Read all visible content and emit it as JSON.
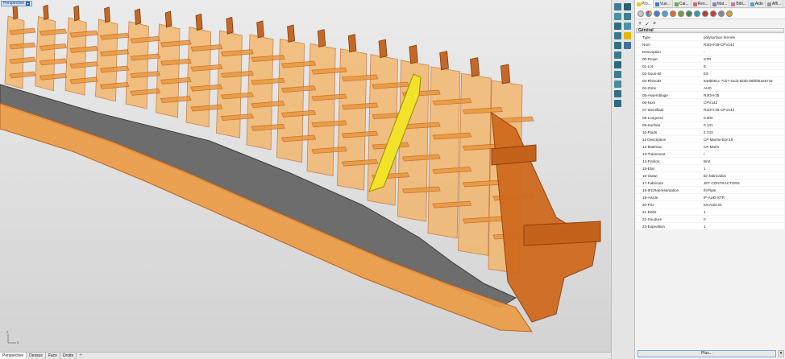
{
  "viewport": {
    "label": "Perspective",
    "axis_x": "x",
    "axis_z": "z",
    "tabs": [
      "Perspective",
      "Dessus",
      "Face",
      "Droite"
    ],
    "active_tab": "Perspective",
    "add_tab": "+"
  },
  "panel": {
    "tabs": [
      {
        "label": "Pro...",
        "color": "#f5c518"
      },
      {
        "label": "Vue...",
        "color": "#3a7bd5"
      },
      {
        "label": "Cal...",
        "color": "#6aa84f"
      },
      {
        "label": "Ren...",
        "color": "#e06666"
      },
      {
        "label": "Mat...",
        "color": "#8e7cc3"
      },
      {
        "label": "Bibl...",
        "color": "#c27ba0"
      },
      {
        "label": "Aide",
        "color": "#4ea1d3"
      },
      {
        "label": "Affi...",
        "color": "#999999"
      }
    ],
    "actions": [
      "+",
      "✓",
      "×"
    ],
    "section": "Général",
    "properties": [
      {
        "key": "Type",
        "value": "polysurface fermée"
      },
      {
        "key": "Nom",
        "value": "R3OH-35-CPV142"
      },
      {
        "key": "Description",
        "value": "-"
      },
      {
        "key": "00-Projet",
        "value": "STR"
      },
      {
        "key": "01-Lot",
        "value": "E"
      },
      {
        "key": "02-Sous-lot",
        "value": "E9"
      },
      {
        "key": "03-RhinoID",
        "value": "640bb61c-7cb7-41cb-923b-b8bf052a67c8"
      },
      {
        "key": "04-Zone",
        "value": "AUD"
      },
      {
        "key": "05-Assemblage",
        "value": "R3OH-35"
      },
      {
        "key": "06-Nom",
        "value": "CPV142"
      },
      {
        "key": "07-Identifiant",
        "value": "R3OH-35-CPV142"
      },
      {
        "key": "08-Longueur",
        "value": "0.000"
      },
      {
        "key": "09-Surface",
        "value": "0.141"
      },
      {
        "key": "10-Poids",
        "value": "2.743"
      },
      {
        "key": "11-Description",
        "value": "CP Marine Epr 18"
      },
      {
        "key": "12-Matériau",
        "value": "CP Marin"
      },
      {
        "key": "13-Traitement",
        "value": "/"
      },
      {
        "key": "14-Finition",
        "value": "Brut"
      },
      {
        "key": "15-Etat",
        "value": "1"
      },
      {
        "key": "16-Statut",
        "value": "En fabrication"
      },
      {
        "key": "17-Fabricant",
        "value": "JET CONTRACTORS"
      },
      {
        "key": "18-IFCRepresentation",
        "value": "IfcPlate"
      },
      {
        "key": "19-Article",
        "value": "IF-AUD-STR"
      },
      {
        "key": "20-Prix",
        "value": "E9.AUD.01"
      },
      {
        "key": "21-Debit",
        "value": "1"
      },
      {
        "key": "22-Soudure",
        "value": "0"
      },
      {
        "key": "23-Expedition",
        "value": "1"
      }
    ],
    "more_button": "Plus...",
    "more_caret": "▾"
  },
  "colors": {
    "wood": "#e9963a",
    "wood_dark": "#c4621c",
    "wood_light": "#f4b25f",
    "selected": "#f2e22a",
    "deck": "#6d6d6d",
    "accent": "#7aa7dd"
  }
}
